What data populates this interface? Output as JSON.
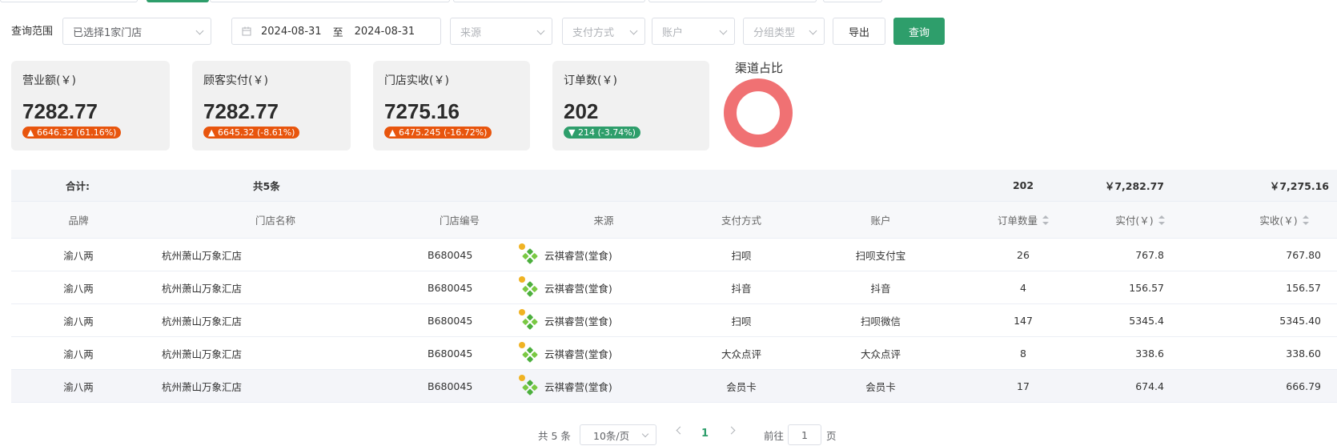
{
  "filters": {
    "scope_label": "查询范围",
    "store_select": "已选择1家门店",
    "date_start": "2024-08-31",
    "date_sep": "至",
    "date_end": "2024-08-31",
    "source_placeholder": "来源",
    "payment_placeholder": "支付方式",
    "account_placeholder": "账户",
    "group_placeholder": "分组类型",
    "export_label": "导出",
    "query_label": "查询"
  },
  "kpis": [
    {
      "title": "营业额(￥)",
      "value": "7282.77",
      "change": "▲ 6646.32 (61.16%)",
      "direction": "up"
    },
    {
      "title": "顾客实付(￥)",
      "value": "7282.77",
      "change": "▲ 6645.32 (-8.61%)",
      "direction": "up"
    },
    {
      "title": "门店实收(￥)",
      "value": "7275.16",
      "change": "▲ 6475.245 (-16.72%)",
      "direction": "up"
    },
    {
      "title": "订单数(￥)",
      "value": "202",
      "change": "▼ 214 (-3.74%)",
      "direction": "down"
    }
  ],
  "channel_chart": {
    "title": "渠道占比",
    "color": "#f07173",
    "share": 1.0
  },
  "table": {
    "summary": {
      "label": "合计:",
      "count": "共5条",
      "orders": "202",
      "paid": "￥7,282.77",
      "received": "￥7,275.16"
    },
    "headers": {
      "brand": "品牌",
      "store": "门店名称",
      "code": "门店编号",
      "source": "来源",
      "payment": "支付方式",
      "account": "账户",
      "orders": "订单数量",
      "paid": "实付(￥)",
      "received": "实收(￥)"
    },
    "rows": [
      {
        "brand": "渝八两",
        "store": "杭州萧山万象汇店",
        "code": "B680045",
        "source": "云祺睿营(堂食)",
        "payment": "扫呗",
        "account": "扫呗支付宝",
        "orders": "26",
        "paid": "767.8",
        "received": "767.80"
      },
      {
        "brand": "渝八两",
        "store": "杭州萧山万象汇店",
        "code": "B680045",
        "source": "云祺睿营(堂食)",
        "payment": "抖音",
        "account": "抖音",
        "orders": "4",
        "paid": "156.57",
        "received": "156.57"
      },
      {
        "brand": "渝八两",
        "store": "杭州萧山万象汇店",
        "code": "B680045",
        "source": "云祺睿营(堂食)",
        "payment": "扫呗",
        "account": "扫呗微信",
        "orders": "147",
        "paid": "5345.4",
        "received": "5345.40"
      },
      {
        "brand": "渝八两",
        "store": "杭州萧山万象汇店",
        "code": "B680045",
        "source": "云祺睿营(堂食)",
        "payment": "大众点评",
        "account": "大众点评",
        "orders": "8",
        "paid": "338.6",
        "received": "338.60"
      },
      {
        "brand": "渝八两",
        "store": "杭州萧山万象汇店",
        "code": "B680045",
        "source": "云祺睿营(堂食)",
        "payment": "会员卡",
        "account": "会员卡",
        "orders": "17",
        "paid": "674.4",
        "received": "666.79"
      }
    ]
  },
  "pagination": {
    "total": "共 5 条",
    "page_size": "10条/页",
    "current": "1",
    "goto_label": "前往",
    "goto_value": "1",
    "page_unit": "页"
  },
  "colors": {
    "accent": "#2e9e6b",
    "up": "#e8550d",
    "down": "#2e9e6b"
  }
}
